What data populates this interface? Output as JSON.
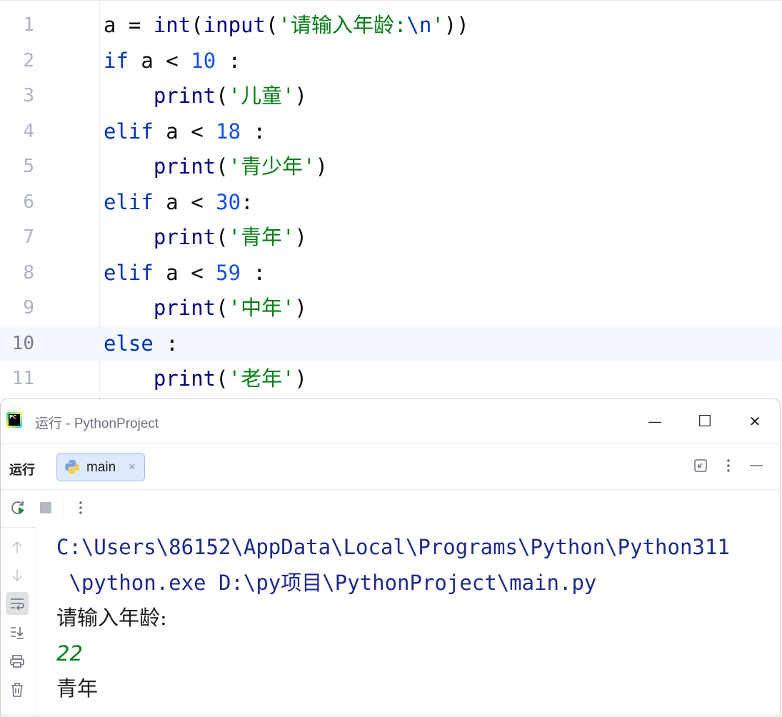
{
  "editor": {
    "current_line": 10,
    "lines": [
      {
        "no": "1"
      },
      {
        "no": "2"
      },
      {
        "no": "3"
      },
      {
        "no": "4"
      },
      {
        "no": "5"
      },
      {
        "no": "6"
      },
      {
        "no": "7"
      },
      {
        "no": "8"
      },
      {
        "no": "9"
      },
      {
        "no": "10"
      },
      {
        "no": "11"
      }
    ],
    "code": {
      "l1": {
        "a": "a = ",
        "int": "int",
        "p1": "(",
        "input": "input",
        "p2": "(",
        "str": "'请输入年龄:",
        "esc": "\\n",
        "str_end": "'",
        "p3": "))"
      },
      "l2": {
        "kw": "if",
        "mid": " a < ",
        "num": "10",
        "end": " :"
      },
      "l3": {
        "indent": "    ",
        "fn": "print",
        "p1": "(",
        "str": "'儿童'",
        "p2": ")"
      },
      "l4": {
        "kw": "elif",
        "mid": " a < ",
        "num": "18",
        "end": " :"
      },
      "l5": {
        "indent": "    ",
        "fn": "print",
        "p1": "(",
        "str": "'青少年'",
        "p2": ")"
      },
      "l6": {
        "kw": "elif",
        "mid": " a < ",
        "num": "30",
        "end": ":"
      },
      "l7": {
        "indent": "    ",
        "fn": "print",
        "p1": "(",
        "str": "'青年'",
        "p2": ")"
      },
      "l8": {
        "kw": "elif",
        "mid": " a < ",
        "num": "59",
        "end": " :"
      },
      "l9": {
        "indent": "    ",
        "fn": "print",
        "p1": "(",
        "str": "'中年'",
        "p2": ")"
      },
      "l10": {
        "kw": "else",
        "end": " :"
      },
      "l11": {
        "indent": "    ",
        "fn": "print",
        "p1": "(",
        "str": "'老年'",
        "p2": ")"
      }
    }
  },
  "run_window": {
    "title": "运行 - PythonProject",
    "logo_text": "PC",
    "minimize": "—",
    "maximize": "☐",
    "close": "✕",
    "run_label": "运行",
    "tab": {
      "label": "main",
      "close": "×"
    },
    "console": {
      "path_line1": "C:\\Users\\86152\\AppData\\Local\\Programs\\Python\\Python311",
      "path_line2": " \\python.exe D:\\py项目\\PythonProject\\main.py",
      "prompt": "请输入年龄:",
      "user_input": "22",
      "output": "青年"
    }
  },
  "colors": {
    "keyword": "#0033b3",
    "number": "#1750eb",
    "string": "#067d17",
    "path": "#1e2a8c",
    "current_line_bg": "#f5f8fe",
    "tab_bg": "#dfe9fd"
  }
}
